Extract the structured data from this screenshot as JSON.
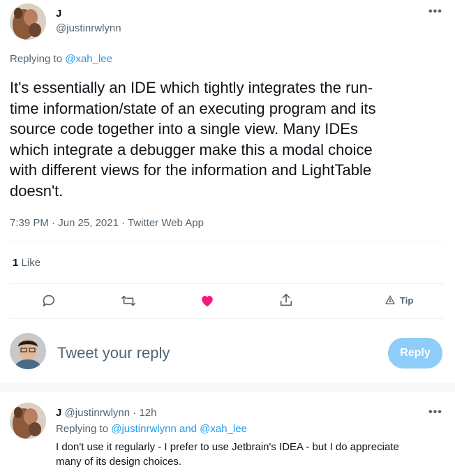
{
  "main_tweet": {
    "author_name": "J",
    "author_handle": "@justinrwlynn",
    "replying_to_prefix": "Replying to",
    "replying_to_handle": "@xah_lee",
    "lines": [
      "It's essentially an IDE which tightly integrates the run-",
      "time information/state of an executing program and its",
      "source code together into a single view. Many IDEs",
      "which integrate a debugger make this a modal choice",
      "with different views for the information and LightTable",
      "doesn't."
    ],
    "timestamp": "7:39 PM · Jun 25, 2021 · Twitter Web App",
    "like_count": "1",
    "like_label": "Like",
    "more_label": "•••"
  },
  "actions": {
    "tip_label": "Tip",
    "icons": [
      "reply-icon",
      "retweet-icon",
      "like-icon",
      "share-icon",
      "tip-icon"
    ],
    "liked_color": "#f91880"
  },
  "composer": {
    "placeholder": "Tweet your reply",
    "reply_button": "Reply",
    "button_color": "#8ecdf8"
  },
  "reply": {
    "author_name": "J",
    "author_handle": "@justinrwlynn",
    "time_ago": "· 12h",
    "replying_to_prefix": "Replying to",
    "replying_to_handles": "@justinrwlynn and @xah_lee",
    "lines": [
      "I don't use it regularly - I prefer to use Jetbrain's IDEA - but I do appreciate",
      "many of its design choices."
    ],
    "more_label": "•••"
  }
}
